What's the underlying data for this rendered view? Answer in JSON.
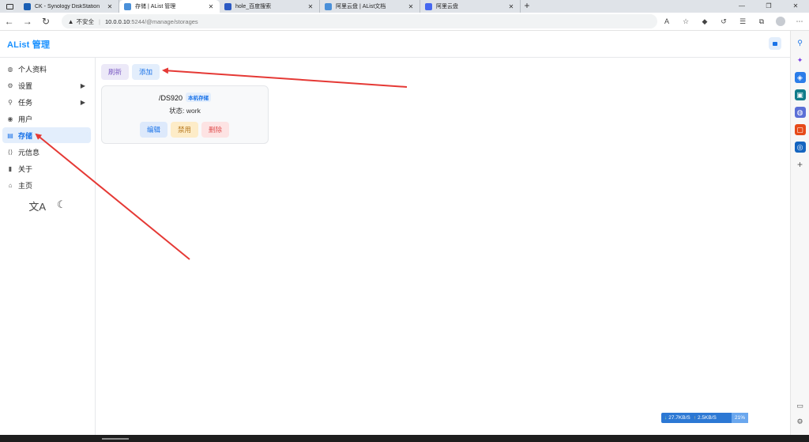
{
  "browser": {
    "tabs": [
      {
        "label": "CK - Synology DiskStation",
        "color": "#1a5fb4",
        "active": false
      },
      {
        "label": "存储 | AList 管理",
        "color": "#4a90d9",
        "active": true
      },
      {
        "label": "hole_百度搜索",
        "color": "#2b59c3",
        "active": false
      },
      {
        "label": "阿里云盘 | AList文档",
        "color": "#4a90d9",
        "active": false
      },
      {
        "label": "阿里云盘",
        "color": "#4668f0",
        "active": false
      }
    ],
    "close_glyph": "✕",
    "new_tab_glyph": "+",
    "insecure_label": "不安全",
    "url_host": "10.0.0.10",
    "url_path": ":5244/@manage/storages"
  },
  "app": {
    "title": "AList 管理",
    "sidebar": {
      "items": [
        {
          "label": "个人资料",
          "icon": "palette-icon",
          "glyph": "◍"
        },
        {
          "label": "设置",
          "icon": "gear-icon",
          "glyph": "⚙",
          "has_arrow": true
        },
        {
          "label": "任务",
          "icon": "tasks-icon",
          "glyph": "⚲",
          "has_arrow": true
        },
        {
          "label": "用户",
          "icon": "user-icon",
          "glyph": "◉"
        },
        {
          "label": "存储",
          "icon": "database-icon",
          "glyph": "▤",
          "active": true
        },
        {
          "label": "元信息",
          "icon": "meta-icon",
          "glyph": "⟨⟩"
        },
        {
          "label": "关于",
          "icon": "chat-icon",
          "glyph": "▮"
        },
        {
          "label": "主页",
          "icon": "home-icon",
          "glyph": "⌂"
        }
      ],
      "arrow_glyph": "▶"
    },
    "toolbar": {
      "refresh_label": "刷新",
      "add_label": "添加"
    },
    "storage_card": {
      "path": "/DS920",
      "driver_badge": "本机存储",
      "status_text": "状态: work",
      "edit_label": "编辑",
      "disable_label": "禁用",
      "delete_label": "删除"
    }
  },
  "net_monitor": {
    "download": "27.7KB/S",
    "upload": "2.5KB/S",
    "percent": "21%"
  },
  "colors": {
    "accent": "#1890ff",
    "annotation_arrow": "#e53935"
  }
}
